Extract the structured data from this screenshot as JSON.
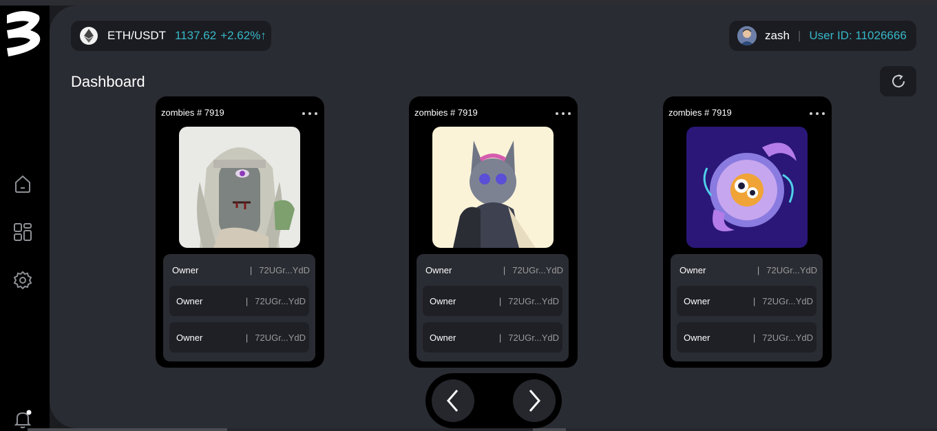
{
  "ticker": {
    "pair": "ETH/USDT",
    "price": "1137.62",
    "change": "+2.62%↑"
  },
  "user": {
    "name": "zash",
    "separator": "|",
    "user_id": "User ID: 11026666"
  },
  "page": {
    "title": "Dashboard"
  },
  "sidebar": {
    "icons": [
      "home-icon",
      "grid-icon",
      "gear-icon",
      "bell-icon"
    ]
  },
  "cards": [
    {
      "title": "zombies # 7919",
      "image": "zombie-nft-image",
      "owners": [
        {
          "label": "Owner",
          "sep": "|",
          "value": "72UGr...YdD"
        },
        {
          "label": "Owner",
          "sep": "|",
          "value": "72UGr...YdD"
        },
        {
          "label": "Owner",
          "sep": "|",
          "value": "72UGr...YdD"
        }
      ]
    },
    {
      "title": "zombies # 7919",
      "image": "lynx-nft-image",
      "owners": [
        {
          "label": "Owner",
          "sep": "|",
          "value": "72UGr...YdD"
        },
        {
          "label": "Owner",
          "sep": "|",
          "value": "72UGr...YdD"
        },
        {
          "label": "Owner",
          "sep": "|",
          "value": "72UGr...YdD"
        }
      ]
    },
    {
      "title": "zombies # 7919",
      "image": "eyeball-creature-nft-image",
      "owners": [
        {
          "label": "Owner",
          "sep": "|",
          "value": "72UGr...YdD"
        },
        {
          "label": "Owner",
          "sep": "|",
          "value": "72UGr...YdD"
        },
        {
          "label": "Owner",
          "sep": "|",
          "value": "72UGr...YdD"
        }
      ]
    }
  ],
  "colors": {
    "accent": "#36b8c8",
    "background": "#2a2c33",
    "panel": "#1b1c21"
  }
}
